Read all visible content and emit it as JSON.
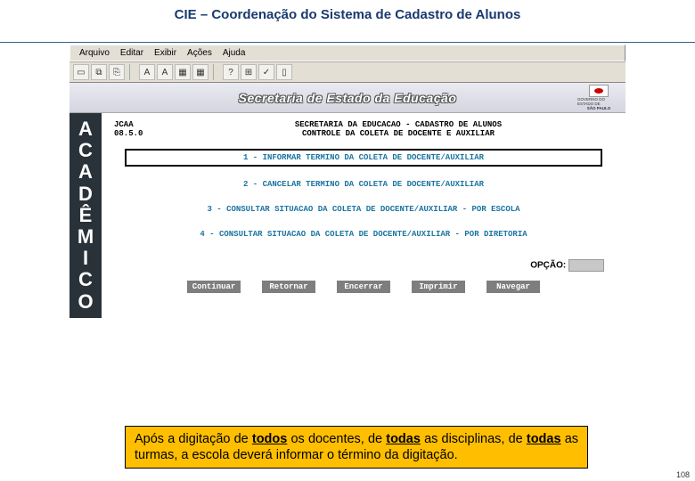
{
  "slide": {
    "title": "CIE – Coordenação do Sistema de Cadastro de Alunos",
    "page_number": "108"
  },
  "menubar": {
    "items": [
      "Arquivo",
      "Editar",
      "Exibir",
      "Ações",
      "Ajuda"
    ]
  },
  "toolbar": {
    "icons": [
      {
        "name": "new-icon",
        "glyph": "▭"
      },
      {
        "name": "copy-icon",
        "glyph": "⧉"
      },
      {
        "name": "paste-icon",
        "glyph": "⎘"
      },
      {
        "sep": true
      },
      {
        "name": "a-icon",
        "glyph": "A"
      },
      {
        "name": "a2-icon",
        "glyph": "A"
      },
      {
        "name": "grid-icon",
        "glyph": "▦"
      },
      {
        "name": "grid2-icon",
        "glyph": "▦"
      },
      {
        "sep": true
      },
      {
        "name": "help-icon",
        "glyph": "?"
      },
      {
        "name": "calc-icon",
        "glyph": "⊞"
      },
      {
        "name": "check-icon",
        "glyph": "✓"
      },
      {
        "name": "doc-icon",
        "glyph": "▯"
      }
    ]
  },
  "banner": {
    "text": "Secretaria de Estado da Educação",
    "logo_line1": "GOVERNO DO ESTADO DE",
    "logo_line2": "SÃO PAULO"
  },
  "sidebar": {
    "letters": [
      "A",
      "C",
      "A",
      "D",
      "Ê",
      "M",
      "I",
      "C",
      "O"
    ]
  },
  "terminal": {
    "code": "JCAA",
    "version": "08.5.0",
    "title1": "SECRETARIA DA EDUCACAO - CADASTRO DE ALUNOS",
    "title2": "CONTROLE DA COLETA DE DOCENTE E AUXILIAR",
    "menu": [
      "1 - INFORMAR TERMINO DA COLETA DE DOCENTE/AUXILIAR",
      "2 - CANCELAR TERMINO DA COLETA DE DOCENTE/AUXILIAR",
      "3 - CONSULTAR SITUACAO DA COLETA DE DOCENTE/AUXILIAR - POR ESCOLA",
      "4 - CONSULTAR SITUACAO DA COLETA DE DOCENTE/AUXILIAR - POR DIRETORIA"
    ],
    "opcao_label": "OPÇÃO:",
    "opcao_value": ""
  },
  "buttons": {
    "items": [
      "Continuar",
      "Retornar",
      "Encerrar",
      "Imprimir",
      "Navegar"
    ]
  },
  "note": {
    "p1a": "Após a digitação de ",
    "u1": "todos",
    "p1b": " os docentes, de ",
    "u2": "todas",
    "p1c": " as disciplinas, de ",
    "u3": "todas",
    "p1d": " as turmas, a escola deverá informar o término da digitação."
  }
}
